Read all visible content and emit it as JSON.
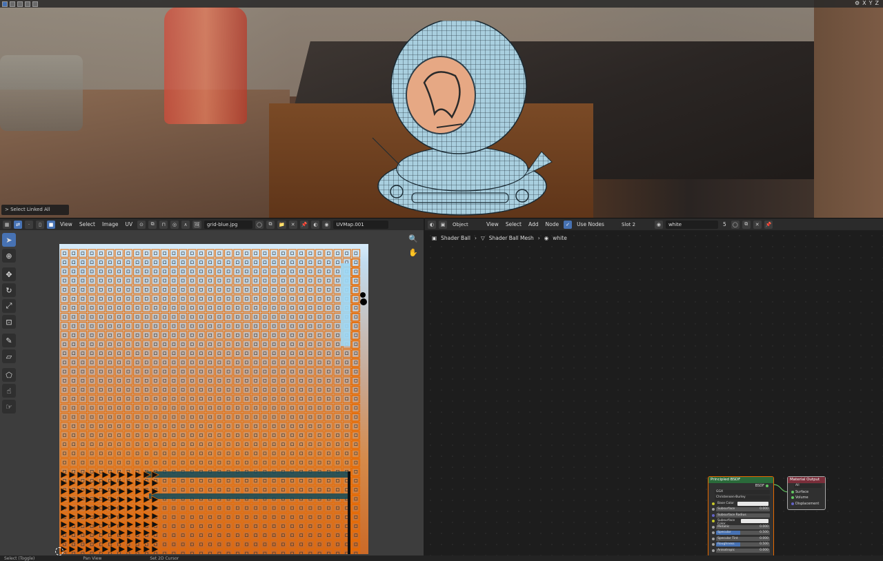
{
  "viewport": {
    "status_text": "Select Linked All",
    "axes": [
      "X",
      "Y",
      "Z"
    ]
  },
  "uv_header": {
    "menus": [
      "View",
      "Select",
      "Image",
      "UV"
    ],
    "image_name": "grid-blue.jpg",
    "uv_map": "UVMap.001"
  },
  "uv_editor": {
    "tools": [
      "cursor",
      "crosshair",
      "move",
      "rotate",
      "scale",
      "transform",
      "annotate",
      "box",
      "rip",
      "grab",
      "relax"
    ]
  },
  "node_header": {
    "mode": "Object",
    "menus": [
      "View",
      "Select",
      "Add",
      "Node"
    ],
    "use_nodes_label": "Use Nodes",
    "slot": "Slot 2",
    "material": "white",
    "user_count": "5"
  },
  "breadcrumb": {
    "object": "Shader Ball",
    "mesh": "Shader Ball Mesh",
    "material": "white"
  },
  "nodes": {
    "bsdf": {
      "title": "Principled BSDF",
      "output": "BSDF",
      "distribution": "GGX",
      "subsurface_method": "Christensen-Burley",
      "rows": [
        {
          "label": "Base Color",
          "value": "",
          "kind": "white"
        },
        {
          "label": "Subsurface",
          "value": "0.000",
          "kind": "num"
        },
        {
          "label": "Subsurface Radius",
          "value": "",
          "kind": "dropdown"
        },
        {
          "label": "Subsurface Color",
          "value": "",
          "kind": "white"
        },
        {
          "label": "Metallic",
          "value": "0.000",
          "kind": "num"
        },
        {
          "label": "Specular",
          "value": "0.500",
          "kind": "blue"
        },
        {
          "label": "Specular Tint",
          "value": "0.000",
          "kind": "num"
        },
        {
          "label": "Roughness",
          "value": "0.500",
          "kind": "blue"
        },
        {
          "label": "Anisotropic",
          "value": "0.000",
          "kind": "num"
        }
      ]
    },
    "output": {
      "title": "Material Output",
      "target": "All",
      "inputs": [
        "Surface",
        "Volume",
        "Displacement"
      ]
    }
  },
  "statusbar": {
    "items": [
      "Select (Toggle)",
      "Pan View",
      "Set 2D Cursor"
    ]
  },
  "colors": {
    "accent": "#4772b3",
    "selection": "#e86a00"
  }
}
